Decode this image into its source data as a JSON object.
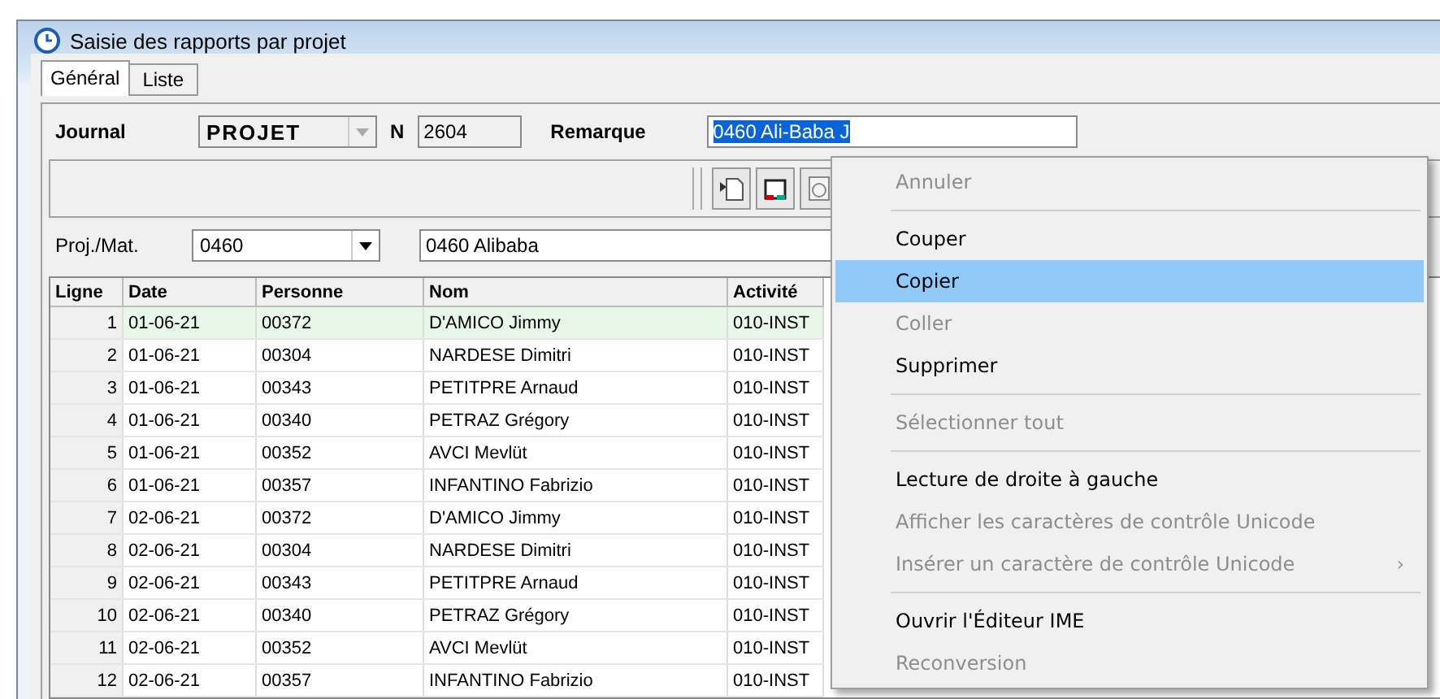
{
  "window": {
    "title": "Saisie des rapports par projet"
  },
  "tabs": [
    {
      "label": "Général",
      "selected": true
    },
    {
      "label": "Liste",
      "selected": false
    }
  ],
  "header": {
    "journal_label": "Journal",
    "journal_value": "PROJET",
    "n_label": "N",
    "n_value": "2604",
    "remarque_label": "Remarque",
    "remarque_value": "0460 Ali-Baba J"
  },
  "project": {
    "label": "Proj./Mat.",
    "code": "0460",
    "name": "0460 Alibaba"
  },
  "table": {
    "columns": [
      "Ligne",
      "Date",
      "Personne",
      "Nom",
      "Activité"
    ],
    "rows": [
      {
        "cells": [
          "1",
          "01-06-21",
          "00372",
          "D'AMICO Jimmy",
          "010-INST"
        ],
        "selected": true
      },
      {
        "cells": [
          "2",
          "01-06-21",
          "00304",
          "NARDESE Dimitri",
          "010-INST"
        ],
        "selected": false
      },
      {
        "cells": [
          "3",
          "01-06-21",
          "00343",
          "PETITPRE Arnaud",
          "010-INST"
        ],
        "selected": false
      },
      {
        "cells": [
          "4",
          "01-06-21",
          "00340",
          "PETRAZ Grégory",
          "010-INST"
        ],
        "selected": false
      },
      {
        "cells": [
          "5",
          "01-06-21",
          "00352",
          "AVCI Mevlüt",
          "010-INST"
        ],
        "selected": false
      },
      {
        "cells": [
          "6",
          "01-06-21",
          "00357",
          "INFANTINO Fabrizio",
          "010-INST"
        ],
        "selected": false
      },
      {
        "cells": [
          "7",
          "02-06-21",
          "00372",
          "D'AMICO Jimmy",
          "010-INST"
        ],
        "selected": false
      },
      {
        "cells": [
          "8",
          "02-06-21",
          "00304",
          "NARDESE Dimitri",
          "010-INST"
        ],
        "selected": false
      },
      {
        "cells": [
          "9",
          "02-06-21",
          "00343",
          "PETITPRE Arnaud",
          "010-INST"
        ],
        "selected": false
      },
      {
        "cells": [
          "10",
          "02-06-21",
          "00340",
          "PETRAZ Grégory",
          "010-INST"
        ],
        "selected": false
      },
      {
        "cells": [
          "11",
          "02-06-21",
          "00352",
          "AVCI Mevlüt",
          "010-INST"
        ],
        "selected": false
      },
      {
        "cells": [
          "12",
          "02-06-21",
          "00357",
          "INFANTINO Fabrizio",
          "010-INST"
        ],
        "selected": false
      }
    ]
  },
  "context_menu": [
    {
      "kind": "item",
      "label": "Annuler",
      "disabled": true,
      "selected": false
    },
    {
      "kind": "separator"
    },
    {
      "kind": "item",
      "label": "Couper",
      "disabled": false,
      "selected": false
    },
    {
      "kind": "item",
      "label": "Copier",
      "disabled": false,
      "selected": true
    },
    {
      "kind": "item",
      "label": "Coller",
      "disabled": true,
      "selected": false
    },
    {
      "kind": "item",
      "label": "Supprimer",
      "disabled": false,
      "selected": false
    },
    {
      "kind": "separator"
    },
    {
      "kind": "item",
      "label": "Sélectionner tout",
      "disabled": true,
      "selected": false
    },
    {
      "kind": "separator"
    },
    {
      "kind": "item",
      "label": "Lecture de droite à gauche",
      "disabled": false,
      "selected": false
    },
    {
      "kind": "item",
      "label": "Afficher les caractères de contrôle Unicode",
      "disabled": true,
      "selected": false
    },
    {
      "kind": "submenu",
      "label": "Insérer un caractère de contrôle Unicode",
      "arrow": "›",
      "disabled": true,
      "selected": false
    },
    {
      "kind": "separator"
    },
    {
      "kind": "item",
      "label": "Ouvrir l'Éditeur IME",
      "disabled": false,
      "selected": false
    },
    {
      "kind": "item",
      "label": "Reconversion",
      "disabled": true,
      "selected": false
    }
  ]
}
